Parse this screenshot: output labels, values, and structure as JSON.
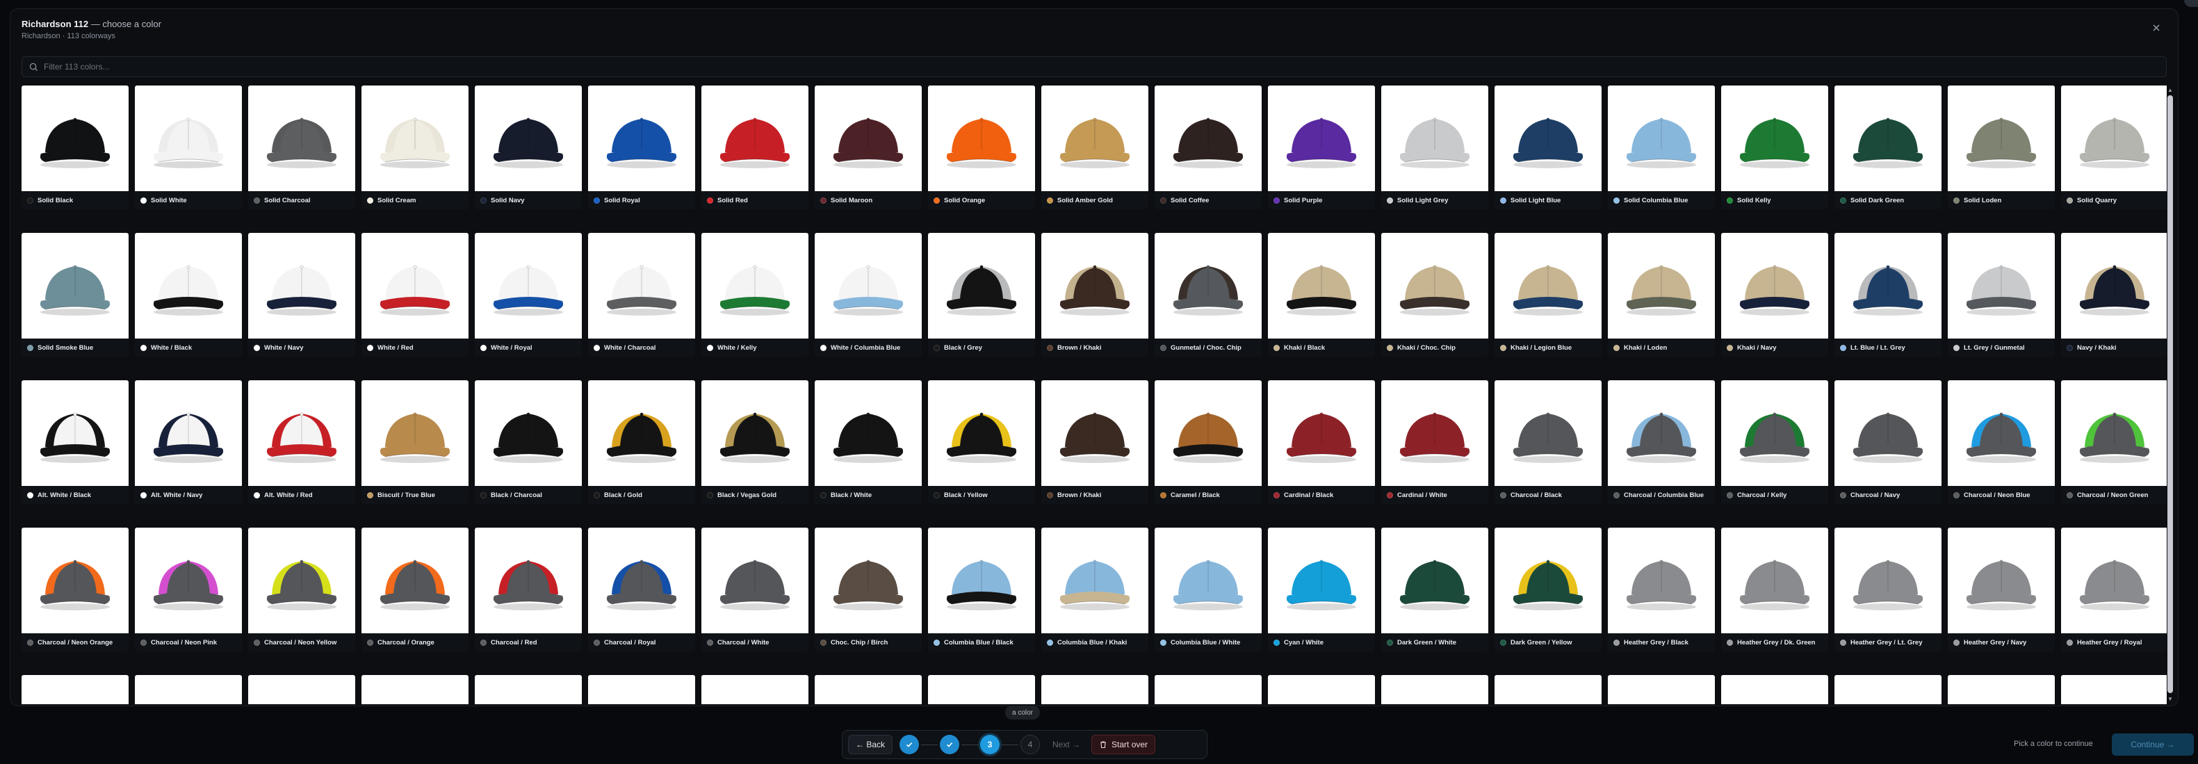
{
  "modal": {
    "title": "Richardson 112",
    "title_suffix": "— choose a color",
    "subtitle": "Richardson · 113 colorways"
  },
  "search": {
    "placeholder": "Filter 113 colors..."
  },
  "icons": {
    "close": "close-icon",
    "search": "search-icon",
    "check": "check-icon",
    "trash": "trash-icon"
  },
  "colors": [
    {
      "label": "Solid Black",
      "crown": "#111214",
      "brim": "#111214",
      "mesh": "#111214",
      "dot": "#1a1a1a"
    },
    {
      "label": "Solid White",
      "crown": "#f3f3f3",
      "brim": "#f3f3f3",
      "mesh": "#ececec",
      "dot": "#ffffff"
    },
    {
      "label": "Solid Charcoal",
      "crown": "#5d5e60",
      "brim": "#5d5e60",
      "mesh": "#58595b",
      "dot": "#5d5e60"
    },
    {
      "label": "Solid Cream",
      "crown": "#efece2",
      "brim": "#efece2",
      "mesh": "#e9e5d8",
      "dot": "#f4f0e4"
    },
    {
      "label": "Solid Navy",
      "crown": "#161c2c",
      "brim": "#161c2c",
      "mesh": "#161c2c",
      "dot": "#1c2438"
    },
    {
      "label": "Solid Royal",
      "crown": "#1550a8",
      "brim": "#1550a8",
      "mesh": "#1550a8",
      "dot": "#1a5fc4"
    },
    {
      "label": "Solid Red",
      "crown": "#c62026",
      "brim": "#c62026",
      "mesh": "#c62026",
      "dot": "#d8262c"
    },
    {
      "label": "Solid Maroon",
      "crown": "#4d2226",
      "brim": "#4d2226",
      "mesh": "#4d2226",
      "dot": "#6b2a30"
    },
    {
      "label": "Solid Orange",
      "crown": "#f0600f",
      "brim": "#f0600f",
      "mesh": "#f0600f",
      "dot": "#f26a1b"
    },
    {
      "label": "Solid Amber Gold",
      "crown": "#c49a55",
      "brim": "#c49a55",
      "mesh": "#c49a55",
      "dot": "#c8954a"
    },
    {
      "label": "Solid Coffee",
      "crown": "#2e2220",
      "brim": "#2e2220",
      "mesh": "#2e2220",
      "dot": "#3b2b28"
    },
    {
      "label": "Solid Purple",
      "crown": "#5a2aa0",
      "brim": "#5a2aa0",
      "mesh": "#5a2aa0",
      "dot": "#6531b4"
    },
    {
      "label": "Solid Light Grey",
      "crown": "#c9cacc",
      "brim": "#c9cacc",
      "mesh": "#c9cacc",
      "dot": "#c9cacc"
    },
    {
      "label": "Solid Light Blue",
      "crown": "#1e3e66",
      "brim": "#1e3e66",
      "mesh": "#1e3e66",
      "dot": "#8db8e6"
    },
    {
      "label": "Solid Columbia Blue",
      "crown": "#88b7dc",
      "brim": "#88b7dc",
      "mesh": "#88b7dc",
      "dot": "#93c1e6"
    },
    {
      "label": "Solid Kelly",
      "crown": "#1d7a32",
      "brim": "#1d7a32",
      "mesh": "#1d7a32",
      "dot": "#1f8a38"
    },
    {
      "label": "Solid Dark Green",
      "crown": "#1c4a3a",
      "brim": "#1c4a3a",
      "mesh": "#1c4a3a",
      "dot": "#1f5a44"
    },
    {
      "label": "Solid Loden",
      "crown": "#7f8372",
      "brim": "#7f8372",
      "mesh": "#7f8372",
      "dot": "#7f8372"
    },
    {
      "label": "Solid Quarry",
      "crown": "#b4b5ae",
      "brim": "#b4b5ae",
      "mesh": "#b4b5ae",
      "dot": "#a8a99f"
    },
    {
      "label": "Solid Smoke Blue",
      "crown": "#6d8f99",
      "brim": "#6d8f99",
      "mesh": "#6d8f99",
      "dot": "#7a9ca8"
    },
    {
      "label": "White / Black",
      "crown": "#f4f4f4",
      "brim": "#141414",
      "mesh": "#f4f4f4",
      "dot": "#ffffff"
    },
    {
      "label": "White / Navy",
      "crown": "#f4f4f4",
      "brim": "#18213a",
      "mesh": "#f4f4f4",
      "dot": "#ffffff"
    },
    {
      "label": "White / Red",
      "crown": "#f4f4f4",
      "brim": "#c62026",
      "mesh": "#f4f4f4",
      "dot": "#ffffff"
    },
    {
      "label": "White / Royal",
      "crown": "#f4f4f4",
      "brim": "#1550a8",
      "mesh": "#f4f4f4",
      "dot": "#ffffff"
    },
    {
      "label": "White / Charcoal",
      "crown": "#f4f4f4",
      "brim": "#5d5e60",
      "mesh": "#f4f4f4",
      "dot": "#ffffff"
    },
    {
      "label": "White / Kelly",
      "crown": "#f4f4f4",
      "brim": "#1d7a32",
      "mesh": "#f4f4f4",
      "dot": "#ffffff"
    },
    {
      "label": "White / Columbia Blue",
      "crown": "#f4f4f4",
      "brim": "#88b7dc",
      "mesh": "#f4f4f4",
      "dot": "#ffffff"
    },
    {
      "label": "Black / Grey",
      "crown": "#141414",
      "brim": "#141414",
      "mesh": "#b9babc",
      "dot": "#1a1a1a"
    },
    {
      "label": "Brown / Khaki",
      "crown": "#3a2a22",
      "brim": "#3a2a22",
      "mesh": "#c4b18e",
      "dot": "#5a3e2e"
    },
    {
      "label": "Gunmetal / Choc. Chip",
      "crown": "#55585c",
      "brim": "#55585c",
      "mesh": "#3a302b",
      "dot": "#55585c"
    },
    {
      "label": "Khaki / Black",
      "crown": "#c7b592",
      "brim": "#141414",
      "mesh": "#c7b592",
      "dot": "#c7b592"
    },
    {
      "label": "Khaki / Choc. Chip",
      "crown": "#c7b592",
      "brim": "#3a302b",
      "mesh": "#c7b592",
      "dot": "#c7b592"
    },
    {
      "label": "Khaki / Legion Blue",
      "crown": "#c7b592",
      "brim": "#1e3e66",
      "mesh": "#c7b592",
      "dot": "#c7b592"
    },
    {
      "label": "Khaki / Loden",
      "crown": "#c7b592",
      "brim": "#5e6354",
      "mesh": "#c7b592",
      "dot": "#c7b592"
    },
    {
      "label": "Khaki / Navy",
      "crown": "#c7b592",
      "brim": "#18213a",
      "mesh": "#c7b592",
      "dot": "#c7b592"
    },
    {
      "label": "Lt. Blue / Lt. Grey",
      "crown": "#1e3e66",
      "brim": "#1e3e66",
      "mesh": "#b9babc",
      "dot": "#8db8e6"
    },
    {
      "label": "Lt. Grey / Gunmetal",
      "crown": "#c9cacc",
      "brim": "#55585c",
      "mesh": "#c9cacc",
      "dot": "#c9cacc"
    },
    {
      "label": "Navy / Khaki",
      "crown": "#161c2c",
      "brim": "#161c2c",
      "mesh": "#c7b592",
      "dot": "#1c2438"
    },
    {
      "label": "Alt. White / Black",
      "crown": "#f4f4f4",
      "brim": "#141414",
      "mesh": "#141414",
      "dot": "#ffffff"
    },
    {
      "label": "Alt. White / Navy",
      "crown": "#f4f4f4",
      "brim": "#18213a",
      "mesh": "#18213a",
      "dot": "#ffffff"
    },
    {
      "label": "Alt. White / Red",
      "crown": "#f4f4f4",
      "brim": "#c62026",
      "mesh": "#c62026",
      "dot": "#ffffff"
    },
    {
      "label": "Biscuit / True Blue",
      "crown": "#b88a4c",
      "brim": "#b88a4c",
      "mesh": "#b88a4c",
      "dot": "#c39a64"
    },
    {
      "label": "Black / Charcoal",
      "crown": "#141414",
      "brim": "#141414",
      "mesh": "#141414",
      "dot": "#1a1a1a"
    },
    {
      "label": "Black / Gold",
      "crown": "#141414",
      "brim": "#141414",
      "mesh": "#d9a21e",
      "dot": "#1a1a1a"
    },
    {
      "label": "Black / Vegas Gold",
      "crown": "#141414",
      "brim": "#141414",
      "mesh": "#b49a52",
      "dot": "#1a1a1a"
    },
    {
      "label": "Black / White",
      "crown": "#141414",
      "brim": "#141414",
      "mesh": "#141414",
      "dot": "#1a1a1a"
    },
    {
      "label": "Black / Yellow",
      "crown": "#141414",
      "brim": "#141414",
      "mesh": "#e8c21a",
      "dot": "#1a1a1a"
    },
    {
      "label": "Brown / Khaki",
      "crown": "#3a2a22",
      "brim": "#3a2a22",
      "mesh": "#3a2a22",
      "dot": "#5a3e2e"
    },
    {
      "label": "Caramel / Black",
      "crown": "#a5642a",
      "brim": "#141414",
      "mesh": "#a5642a",
      "dot": "#b4742e"
    },
    {
      "label": "Cardinal / Black",
      "crown": "#8c2228",
      "brim": "#8c2228",
      "mesh": "#8c2228",
      "dot": "#a02830"
    },
    {
      "label": "Cardinal / White",
      "crown": "#8c2228",
      "brim": "#8c2228",
      "mesh": "#8c2228",
      "dot": "#a02830"
    },
    {
      "label": "Charcoal / Black",
      "crown": "#55565a",
      "brim": "#55565a",
      "mesh": "#55565a",
      "dot": "#5d5e60"
    },
    {
      "label": "Charcoal / Columbia Blue",
      "crown": "#55565a",
      "brim": "#55565a",
      "mesh": "#88b7dc",
      "dot": "#5d5e60"
    },
    {
      "label": "Charcoal / Kelly",
      "crown": "#55565a",
      "brim": "#55565a",
      "mesh": "#1d7a32",
      "dot": "#5d5e60"
    },
    {
      "label": "Charcoal / Navy",
      "crown": "#55565a",
      "brim": "#55565a",
      "mesh": "#55565a",
      "dot": "#5d5e60"
    },
    {
      "label": "Charcoal / Neon Blue",
      "crown": "#55565a",
      "brim": "#55565a",
      "mesh": "#1f9be0",
      "dot": "#5d5e60"
    },
    {
      "label": "Charcoal / Neon Green",
      "crown": "#55565a",
      "brim": "#55565a",
      "mesh": "#4fc33a",
      "dot": "#5d5e60"
    },
    {
      "label": "Charcoal / Neon Orange",
      "crown": "#55565a",
      "brim": "#55565a",
      "mesh": "#f26a1b",
      "dot": "#5d5e60"
    },
    {
      "label": "Charcoal / Neon Pink",
      "crown": "#55565a",
      "brim": "#55565a",
      "mesh": "#d44fd0",
      "dot": "#5d5e60"
    },
    {
      "label": "Charcoal / Neon Yellow",
      "crown": "#55565a",
      "brim": "#55565a",
      "mesh": "#d6e01a",
      "dot": "#5d5e60"
    },
    {
      "label": "Charcoal / Orange",
      "crown": "#55565a",
      "brim": "#55565a",
      "mesh": "#f26a1b",
      "dot": "#5d5e60"
    },
    {
      "label": "Charcoal / Red",
      "crown": "#55565a",
      "brim": "#55565a",
      "mesh": "#c62026",
      "dot": "#5d5e60"
    },
    {
      "label": "Charcoal / Royal",
      "crown": "#55565a",
      "brim": "#55565a",
      "mesh": "#1550a8",
      "dot": "#5d5e60"
    },
    {
      "label": "Charcoal / White",
      "crown": "#55565a",
      "brim": "#55565a",
      "mesh": "#55565a",
      "dot": "#5d5e60"
    },
    {
      "label": "Choc. Chip / Birch",
      "crown": "#5a4e44",
      "brim": "#5a4e44",
      "mesh": "#5a4e44",
      "dot": "#5a4e44"
    },
    {
      "label": "Columbia Blue / Black",
      "crown": "#88b7dc",
      "brim": "#141414",
      "mesh": "#88b7dc",
      "dot": "#93c1e6"
    },
    {
      "label": "Columbia Blue / Khaki",
      "crown": "#88b7dc",
      "brim": "#c7b592",
      "mesh": "#88b7dc",
      "dot": "#93c1e6"
    },
    {
      "label": "Columbia Blue / White",
      "crown": "#88b7dc",
      "brim": "#88b7dc",
      "mesh": "#88b7dc",
      "dot": "#93c1e6"
    },
    {
      "label": "Cyan / White",
      "crown": "#149fd8",
      "brim": "#149fd8",
      "mesh": "#149fd8",
      "dot": "#14a4e0"
    },
    {
      "label": "Dark Green / White",
      "crown": "#1c4a3a",
      "brim": "#1c4a3a",
      "mesh": "#1c4a3a",
      "dot": "#1f5a44"
    },
    {
      "label": "Dark Green / Yellow",
      "crown": "#1c4a3a",
      "brim": "#1c4a3a",
      "mesh": "#e8c21a",
      "dot": "#1f5a44"
    },
    {
      "label": "Heather Grey / Black",
      "crown": "#8a8b8e",
      "brim": "#8a8b8e",
      "mesh": "#8a8b8e",
      "dot": "#9a9b9e"
    },
    {
      "label": "Heather Grey / Dk. Green",
      "crown": "#8a8b8e",
      "brim": "#8a8b8e",
      "mesh": "#8a8b8e",
      "dot": "#9a9b9e"
    },
    {
      "label": "Heather Grey / Lt. Grey",
      "crown": "#8a8b8e",
      "brim": "#8a8b8e",
      "mesh": "#8a8b8e",
      "dot": "#9a9b9e"
    },
    {
      "label": "Heather Grey / Navy",
      "crown": "#8a8b8e",
      "brim": "#8a8b8e",
      "mesh": "#8a8b8e",
      "dot": "#9a9b9e"
    },
    {
      "label": "Heather Grey / Royal",
      "crown": "#8a8b8e",
      "brim": "#8a8b8e",
      "mesh": "#8a8b8e",
      "dot": "#9a9b9e"
    },
    {
      "label": "",
      "crown": "#8a8b8e",
      "brim": "#8a8b8e",
      "mesh": "#8a8b8e",
      "dot": "#9a9b9e"
    },
    {
      "label": "",
      "crown": "#e0769c",
      "brim": "#e0769c",
      "mesh": "#e0769c",
      "dot": "#e0769c"
    },
    {
      "label": "",
      "crown": "#e0769c",
      "brim": "#e0769c",
      "mesh": "#f4f4f4",
      "dot": "#e0769c"
    },
    {
      "label": "",
      "crown": "#1d7a32",
      "brim": "#1d7a32",
      "mesh": "#1d7a32",
      "dot": "#1d7a32"
    },
    {
      "label": "",
      "crown": "#c7b592",
      "brim": "#c7b592",
      "mesh": "#c7b592",
      "dot": "#c7b592"
    },
    {
      "label": "",
      "crown": "#c7b592",
      "brim": "#c7b592",
      "mesh": "#c7b592",
      "dot": "#c7b592"
    },
    {
      "label": "",
      "crown": "#cbbd9c",
      "brim": "#cbbd9c",
      "mesh": "#cbbd9c",
      "dot": "#cbbd9c"
    },
    {
      "label": "",
      "crown": "#7f8372",
      "brim": "#7f8372",
      "mesh": "#7f8372",
      "dot": "#7f8372"
    },
    {
      "label": "",
      "crown": "#4d2226",
      "brim": "#4d2226",
      "mesh": "#4d2226",
      "dot": "#4d2226"
    },
    {
      "label": "",
      "crown": "#161c2c",
      "brim": "#161c2c",
      "mesh": "#161c2c",
      "dot": "#161c2c"
    },
    {
      "label": "",
      "crown": "#161c2c",
      "brim": "#161c2c",
      "mesh": "#161c2c",
      "dot": "#161c2c"
    },
    {
      "label": "",
      "crown": "#161c2c",
      "brim": "#161c2c",
      "mesh": "#161c2c",
      "dot": "#161c2c"
    },
    {
      "label": "",
      "crown": "#161c2c",
      "brim": "#161c2c",
      "mesh": "#f26a1b",
      "dot": "#161c2c"
    },
    {
      "label": "",
      "crown": "#161c2c",
      "brim": "#161c2c",
      "mesh": "#161c2c",
      "dot": "#161c2c"
    },
    {
      "label": "",
      "crown": "#f0600f",
      "brim": "#f0600f",
      "mesh": "#f0600f",
      "dot": "#f0600f"
    },
    {
      "label": "",
      "crown": "#f0600f",
      "brim": "#f0600f",
      "mesh": "#f0600f",
      "dot": "#f0600f"
    },
    {
      "label": "",
      "crown": "#5a2aa0",
      "brim": "#5a2aa0",
      "mesh": "#5a2aa0",
      "dot": "#5a2aa0"
    },
    {
      "label": "",
      "crown": "#c62026",
      "brim": "#c62026",
      "mesh": "#c62026",
      "dot": "#c62026"
    },
    {
      "label": "",
      "crown": "#c62026",
      "brim": "#c62026",
      "mesh": "#c62026",
      "dot": "#c62026"
    }
  ],
  "pill": "a color",
  "stepper": {
    "back_label": "← Back",
    "steps": [
      {
        "label": "✓",
        "state": "done"
      },
      {
        "label": "✓",
        "state": "done"
      },
      {
        "label": "3",
        "state": "active"
      },
      {
        "label": "4",
        "state": "todo"
      }
    ],
    "next_label": "Next →",
    "start_over_label": "Start over"
  },
  "footer": {
    "hint": "Pick a color to continue",
    "continue_label": "Continue →"
  },
  "theme": {
    "accent": "#1f9be0",
    "danger": "#5a2228",
    "bg": "#07090c"
  }
}
